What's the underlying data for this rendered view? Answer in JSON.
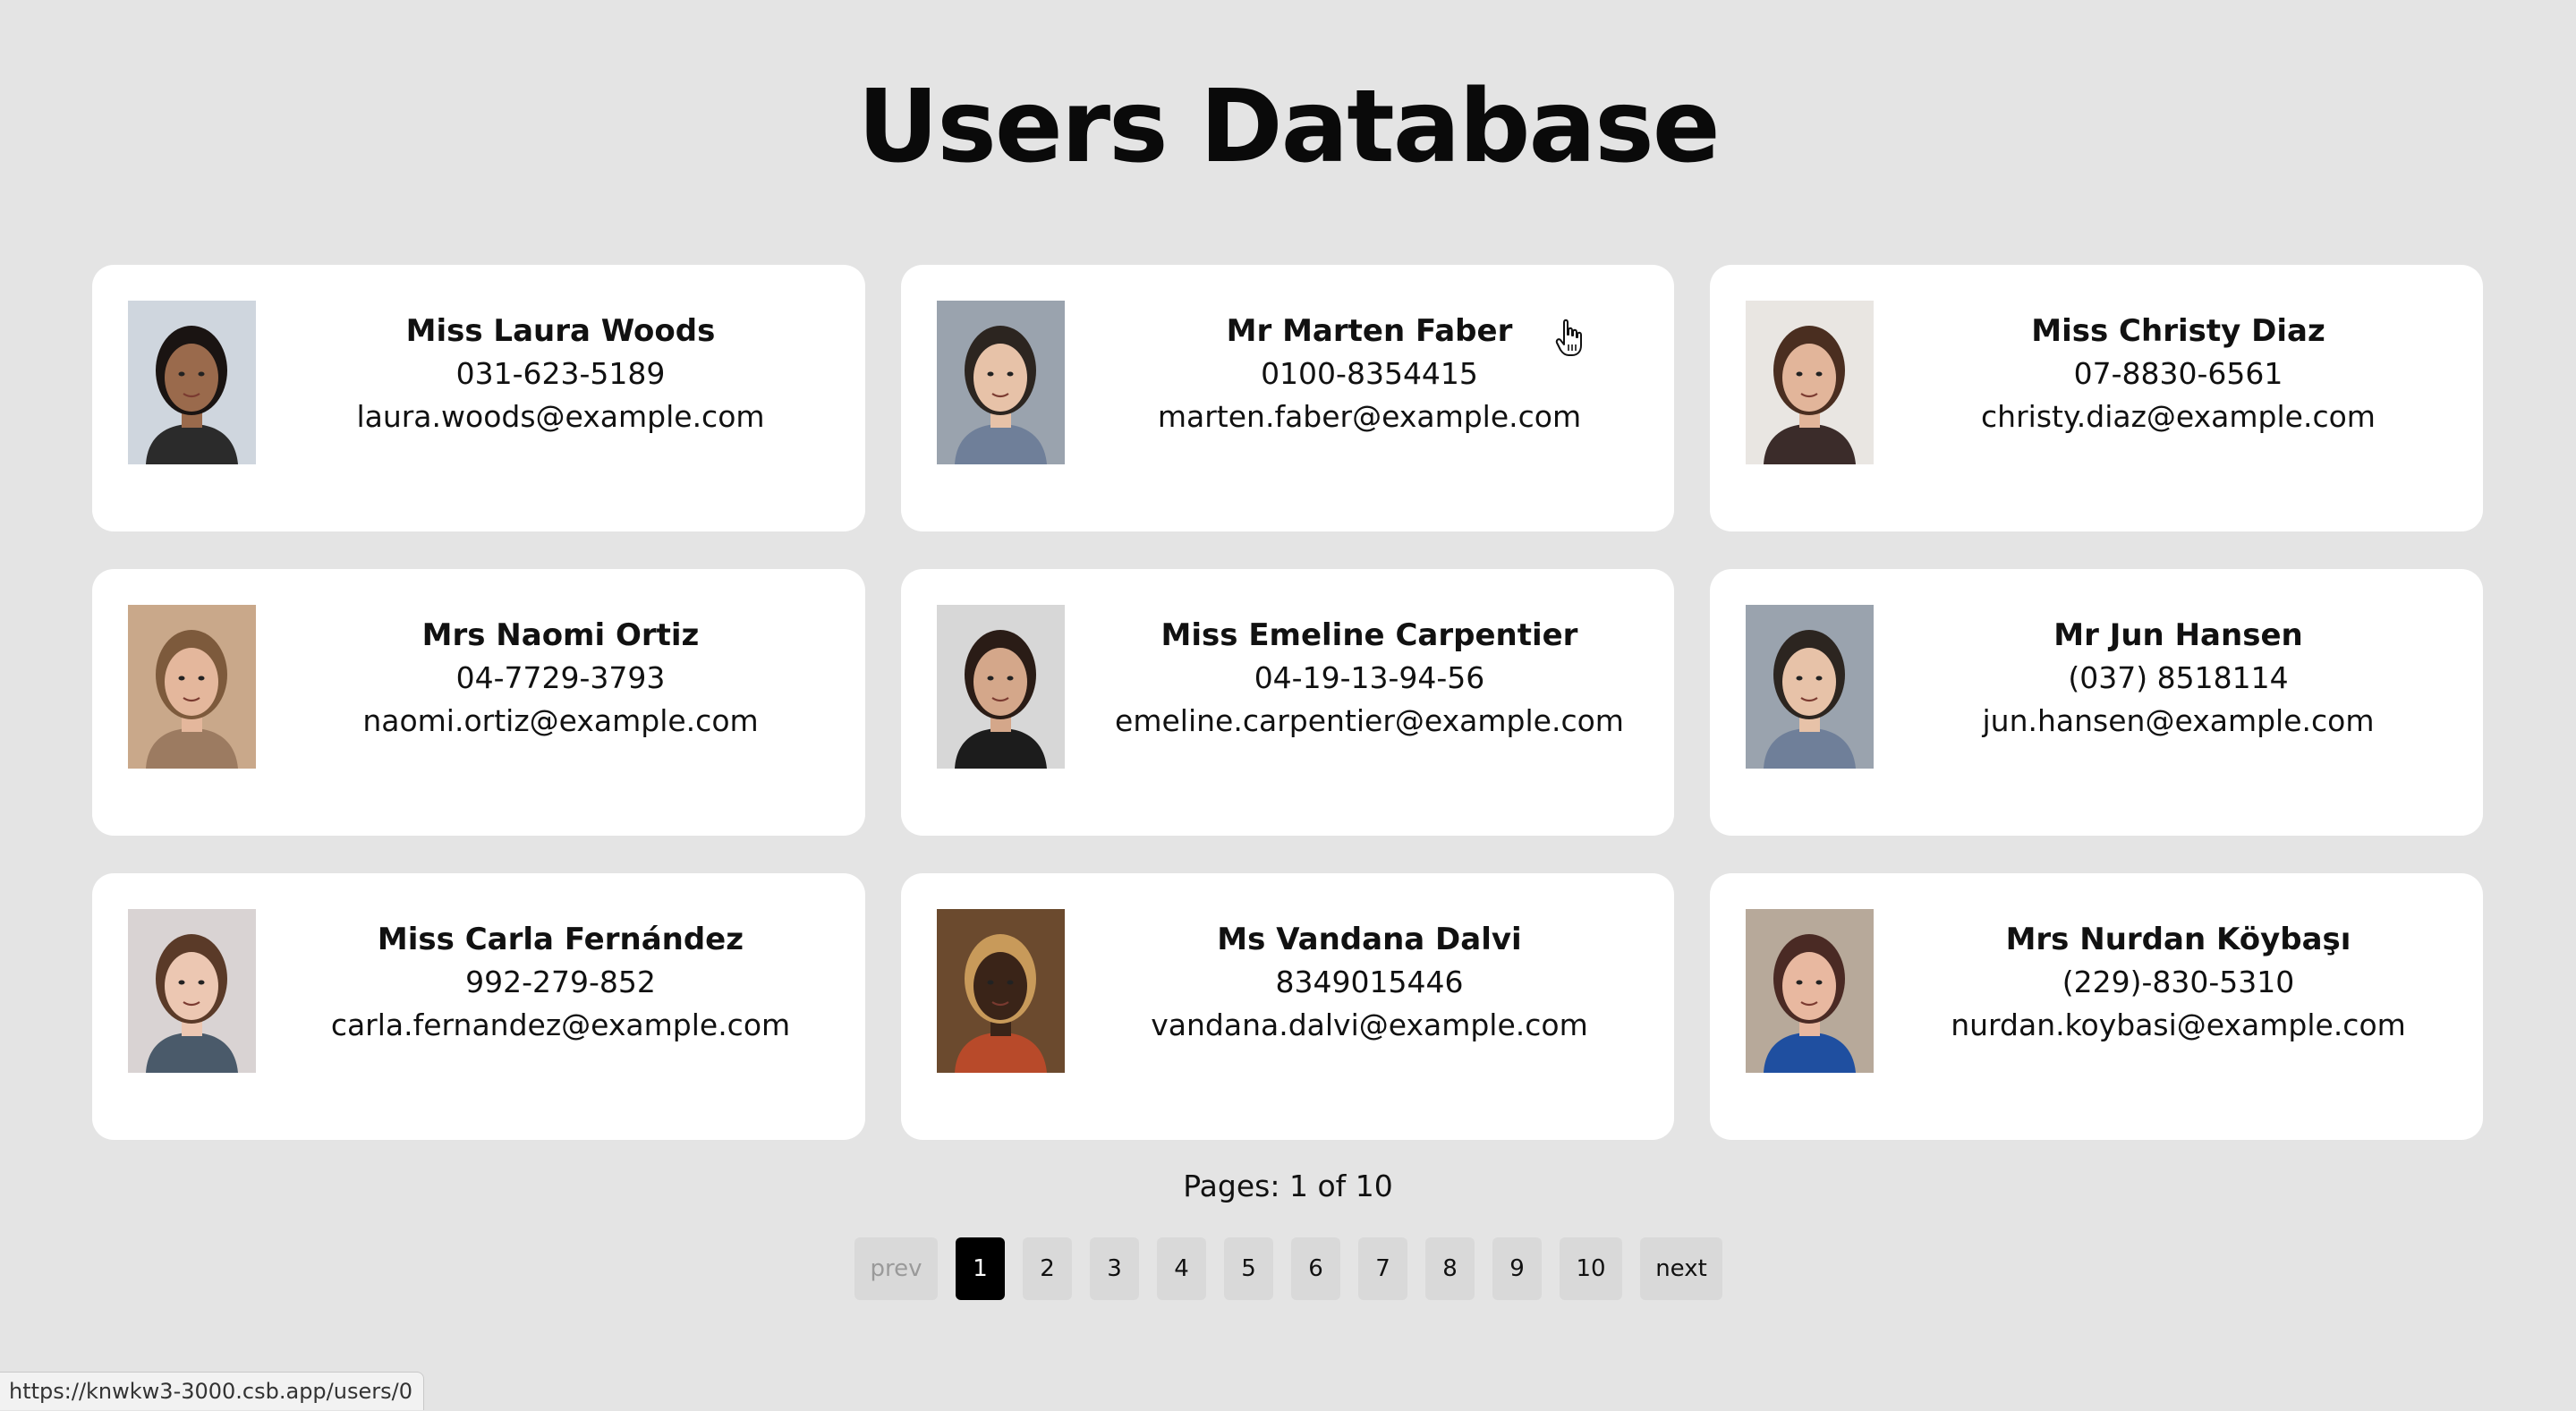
{
  "page": {
    "title": "Users Database",
    "pages_label": "Pages: 1 of 10",
    "status_url": "https://knwkw3-3000.csb.app/users/0"
  },
  "users": [
    {
      "name": "Miss Laura Woods",
      "phone": "031-623-5189",
      "email": "laura.woods@example.com",
      "avatar_bg": "#cfd6de",
      "avatar_skin": "#9a6a4c",
      "avatar_hair": "#1a1412",
      "avatar_cloth": "#2b2b2b"
    },
    {
      "name": "Mr Marten Faber",
      "phone": "0100-8354415",
      "email": "marten.faber@example.com",
      "avatar_bg": "#9aa3ae",
      "avatar_skin": "#e7c2a8",
      "avatar_hair": "#2c2520",
      "avatar_cloth": "#6f7f99"
    },
    {
      "name": "Miss Christy Diaz",
      "phone": "07-8830-6561",
      "email": "christy.diaz@example.com",
      "avatar_bg": "#e9e6e2",
      "avatar_skin": "#e2b59a",
      "avatar_hair": "#4a2e20",
      "avatar_cloth": "#3b2c2a"
    },
    {
      "name": "Mrs Naomi Ortiz",
      "phone": "04-7729-3793",
      "email": "naomi.ortiz@example.com",
      "avatar_bg": "#c9a88a",
      "avatar_skin": "#e4b79c",
      "avatar_hair": "#7d5a3c",
      "avatar_cloth": "#9c7b61"
    },
    {
      "name": "Miss Emeline Carpentier",
      "phone": "04-19-13-94-56",
      "email": "emeline.carpentier@example.com",
      "avatar_bg": "#d7d7d7",
      "avatar_skin": "#d4a78a",
      "avatar_hair": "#2a1c16",
      "avatar_cloth": "#1c1c1c"
    },
    {
      "name": "Mr Jun Hansen",
      "phone": "(037) 8518114",
      "email": "jun.hansen@example.com",
      "avatar_bg": "#9aa3ae",
      "avatar_skin": "#e7c2a8",
      "avatar_hair": "#2c2520",
      "avatar_cloth": "#6f7f99"
    },
    {
      "name": "Miss Carla Fernández",
      "phone": "992-279-852",
      "email": "carla.fernandez@example.com",
      "avatar_bg": "#d9d3d3",
      "avatar_skin": "#ecc7b2",
      "avatar_hair": "#5a3a28",
      "avatar_cloth": "#4a5a6a"
    },
    {
      "name": "Ms Vandana Dalvi",
      "phone": "8349015446",
      "email": "vandana.dalvi@example.com",
      "avatar_bg": "#6b4a2e",
      "avatar_skin": "#3a2418",
      "avatar_hair": "#c89a5a",
      "avatar_cloth": "#b84a2a"
    },
    {
      "name": "Mrs Nurdan Köybaşı",
      "phone": "(229)-830-5310",
      "email": "nurdan.koybasi@example.com",
      "avatar_bg": "#b7a99a",
      "avatar_skin": "#e8b8a0",
      "avatar_hair": "#4a2a24",
      "avatar_cloth": "#1f4fa0"
    }
  ],
  "pagination": {
    "prev_label": "prev",
    "next_label": "next",
    "pages": [
      "1",
      "2",
      "3",
      "4",
      "5",
      "6",
      "7",
      "8",
      "9",
      "10"
    ],
    "current": "1"
  },
  "colors": {
    "background": "#e4e4e4",
    "card": "#ffffff",
    "active_page": "#000000",
    "page_button": "#d9d9d9"
  }
}
